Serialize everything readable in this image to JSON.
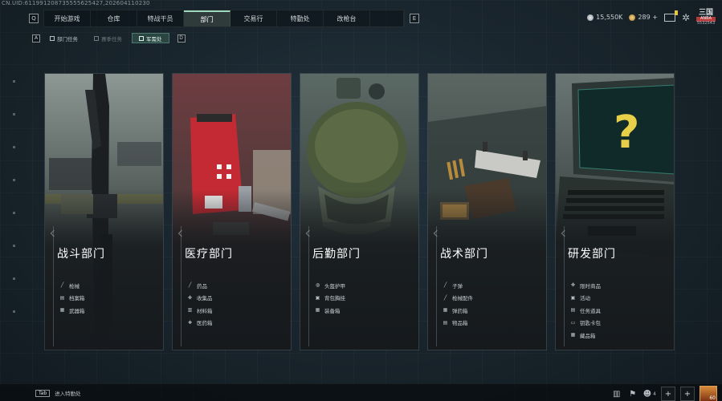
{
  "uid_text": "CN.UID:611991208735555625427,202604110230",
  "nav": {
    "left_key": "Q",
    "right_key": "E",
    "tabs": [
      {
        "label": "开始游戏"
      },
      {
        "label": "仓库"
      },
      {
        "label": "特战干员"
      },
      {
        "label": "部门",
        "active": true
      },
      {
        "label": "交易行"
      },
      {
        "label": "特勤处"
      },
      {
        "label": "改枪台"
      }
    ]
  },
  "currency": {
    "silver": "15,550K",
    "gold": "289 +"
  },
  "brand_badge": {
    "logo": "三国",
    "tag": "ANBA",
    "num": "5532543"
  },
  "subnav": {
    "left_key": "A",
    "right_key": "D",
    "tabs": [
      {
        "label": "部门任务",
        "state": "normal"
      },
      {
        "label": "赛季任务",
        "state": "dim"
      },
      {
        "label": "军需处",
        "state": "active"
      }
    ]
  },
  "cards": [
    {
      "title": "战斗部门",
      "items": [
        {
          "icon": "rifle-icon",
          "glyph": "╱",
          "label": "枪械"
        },
        {
          "icon": "file-box-icon",
          "glyph": "▤",
          "label": "档案箱"
        },
        {
          "icon": "weapon-box-icon",
          "glyph": "▦",
          "label": "武器箱"
        }
      ]
    },
    {
      "title": "医疗部门",
      "items": [
        {
          "icon": "syringe-icon",
          "glyph": "╱",
          "label": "药品"
        },
        {
          "icon": "collectible-icon",
          "glyph": "✤",
          "label": "收集品"
        },
        {
          "icon": "material-icon",
          "glyph": "▥",
          "label": "材料箱"
        },
        {
          "icon": "medkit-icon",
          "glyph": "✚",
          "label": "医药箱"
        }
      ]
    },
    {
      "title": "后勤部门",
      "items": [
        {
          "icon": "helmet-armor-icon",
          "glyph": "◍",
          "label": "头盔护甲"
        },
        {
          "icon": "backpack-icon",
          "glyph": "▣",
          "label": "背包胸挂"
        },
        {
          "icon": "equipment-box-icon",
          "glyph": "▦",
          "label": "装备箱"
        }
      ]
    },
    {
      "title": "战术部门",
      "items": [
        {
          "icon": "bullet-icon",
          "glyph": "╱",
          "label": "子弹"
        },
        {
          "icon": "gun-attachment-icon",
          "glyph": "╱",
          "label": "枪械配件"
        },
        {
          "icon": "ammo-box-icon",
          "glyph": "▦",
          "label": "弹药箱"
        },
        {
          "icon": "item-box-icon",
          "glyph": "▤",
          "label": "物品箱"
        }
      ]
    },
    {
      "title": "研发部门",
      "items": [
        {
          "icon": "limited-goods-icon",
          "glyph": "✤",
          "label": "限时商品"
        },
        {
          "icon": "activity-icon",
          "glyph": "▣",
          "label": "活动"
        },
        {
          "icon": "mission-prop-icon",
          "glyph": "▤",
          "label": "任务道具"
        },
        {
          "icon": "key-card-icon",
          "glyph": "▭",
          "label": "钥匙卡包"
        },
        {
          "icon": "collection-box-icon",
          "glyph": "▦",
          "label": "藏品箱"
        }
      ]
    }
  ],
  "bottom": {
    "tab_key": "Tab",
    "tab_hint": "进入特勤处",
    "friends_count": "4",
    "level": "60"
  }
}
